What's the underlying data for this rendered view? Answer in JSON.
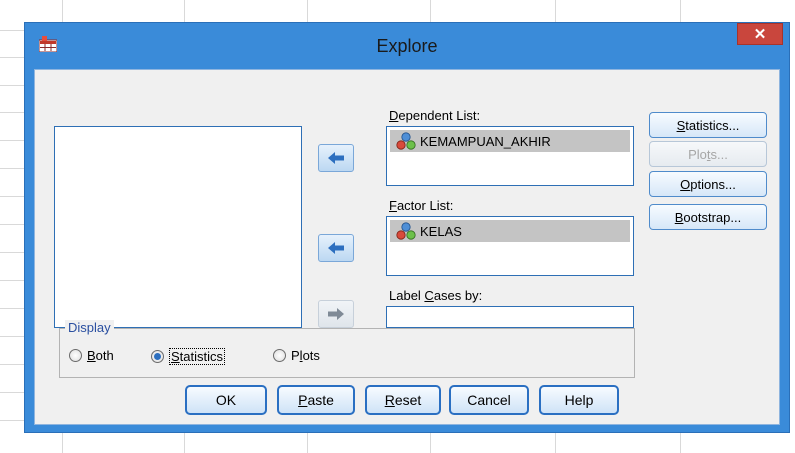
{
  "window": {
    "title": "Explore",
    "close_glyph": "✕"
  },
  "source_list": {
    "items": []
  },
  "dependent_list": {
    "label_pre": "",
    "label_accel": "D",
    "label_post": "ependent List:",
    "items": [
      {
        "name": "KEMAMPUAN_AKHIR",
        "icon": "nominal-variable-icon"
      }
    ]
  },
  "factor_list": {
    "label_pre": "",
    "label_accel": "F",
    "label_post": "actor List:",
    "items": [
      {
        "name": "KELAS",
        "icon": "nominal-variable-icon"
      }
    ]
  },
  "label_cases": {
    "label_pre": "Label ",
    "label_accel": "C",
    "label_post": "ases by:",
    "value": ""
  },
  "side_buttons": {
    "statistics": {
      "pre": "",
      "accel": "S",
      "post": "tatistics..."
    },
    "plots": {
      "pre": "Plo",
      "accel": "t",
      "post": "s..."
    },
    "options": {
      "pre": "",
      "accel": "O",
      "post": "ptions..."
    },
    "bootstrap": {
      "pre": "",
      "accel": "B",
      "post": "ootstrap..."
    }
  },
  "display": {
    "label": "Display",
    "options": [
      {
        "pre": "",
        "accel": "B",
        "post": "oth",
        "checked": false
      },
      {
        "pre": "",
        "accel": "S",
        "post": "tatistics",
        "checked": true
      },
      {
        "pre": "P",
        "accel": "l",
        "post": "ots",
        "checked": false
      }
    ]
  },
  "buttons": {
    "ok": {
      "pre": "OK",
      "accel": "",
      "post": ""
    },
    "paste": {
      "pre": "",
      "accel": "P",
      "post": "aste"
    },
    "reset": {
      "pre": "",
      "accel": "R",
      "post": "eset"
    },
    "cancel": {
      "pre": "Cancel",
      "accel": "",
      "post": ""
    },
    "help": {
      "pre": "Help",
      "accel": "",
      "post": ""
    }
  },
  "colors": {
    "window_frame": "#3a8bd9",
    "close_button": "#c9463d",
    "button_border": "#2a6fc2"
  }
}
